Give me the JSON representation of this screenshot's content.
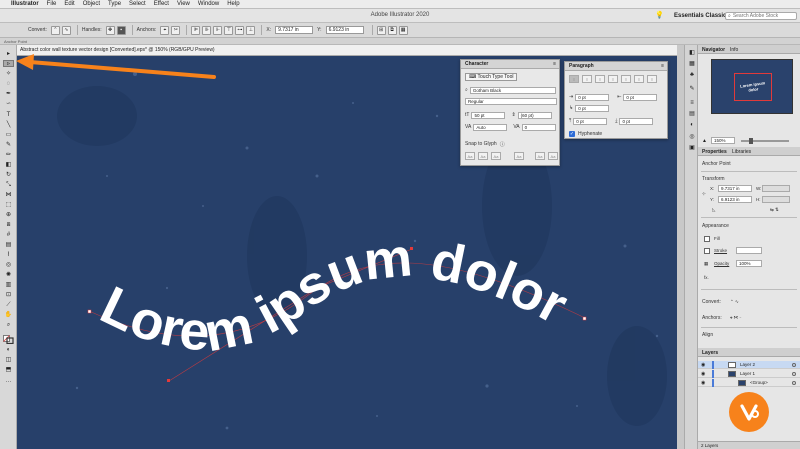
{
  "menubar": {
    "app": "Illustrator",
    "menus": [
      "File",
      "Edit",
      "Object",
      "Type",
      "Select",
      "Effect",
      "View",
      "Window",
      "Help"
    ]
  },
  "app": {
    "window_title": "Adobe Illustrator 2020",
    "workspace": "Essentials Classic",
    "search_placeholder": "Search Adobe Stock"
  },
  "controlbar": {
    "anchor_point": "Anchor Point",
    "convert": "Convert:",
    "handles": "Handles:",
    "anchors": "Anchors:",
    "x_label": "X:",
    "x_value": "9.7317 in",
    "y_label": "Y:",
    "y_value": "6.9123 in"
  },
  "row2": {
    "label": "Anchor Point"
  },
  "document": {
    "tab_title": "Abstract color wall texture vector design [Converted].eps* @ 150% (RGB/GPU Preview)",
    "text": "Lorem ipsum dolor"
  },
  "character_panel": {
    "title": "Character",
    "touch_type": "Touch Type Tool",
    "font_family": "Gotham Black",
    "font_style": "Regular",
    "font_size": "50 pt",
    "leading": "(60 pt)",
    "kerning": "Auto",
    "tracking": "0",
    "snap_to_glyph": "Snap to Glyph",
    "glyph_buttons": [
      "Aa",
      "Aa",
      "Aa",
      "Aa",
      "Aa",
      "Aa"
    ]
  },
  "paragraph_panel": {
    "title": "Paragraph",
    "left_indent": "0 pt",
    "right_indent": "0 pt",
    "first_indent": "0 pt",
    "space_before": "0 pt",
    "space_after": "0 pt",
    "hyphenate": "Hyphenate"
  },
  "navigator": {
    "tabs": [
      "Navigator",
      "Info"
    ],
    "zoom": "150%",
    "thumb_text": "Lorem ipsum dolor"
  },
  "properties": {
    "tabs": [
      "Properties",
      "Libraries"
    ],
    "section": "Anchor Point",
    "transform": "Transform",
    "x_label": "X:",
    "x_value": "9.7317 in",
    "y_label": "Y:",
    "y_value": "6.9123 in",
    "w_label": "W:",
    "h_label": "H:",
    "appearance": "Appearance",
    "fill": "Fill",
    "stroke": "Stroke",
    "opacity": "Opacity",
    "opacity_value": "100%",
    "fx": "fx.",
    "convert": "Convert:",
    "anchors": "Anchors:",
    "align": "Align"
  },
  "layers": {
    "title": "Layers",
    "rows": [
      "Layer 2",
      "Layer 1",
      "<Group>"
    ],
    "count": "2 Layers"
  },
  "colors": {
    "canvas": "#27406a",
    "arrow": "#f7821b",
    "selection": "#e23a3a"
  }
}
